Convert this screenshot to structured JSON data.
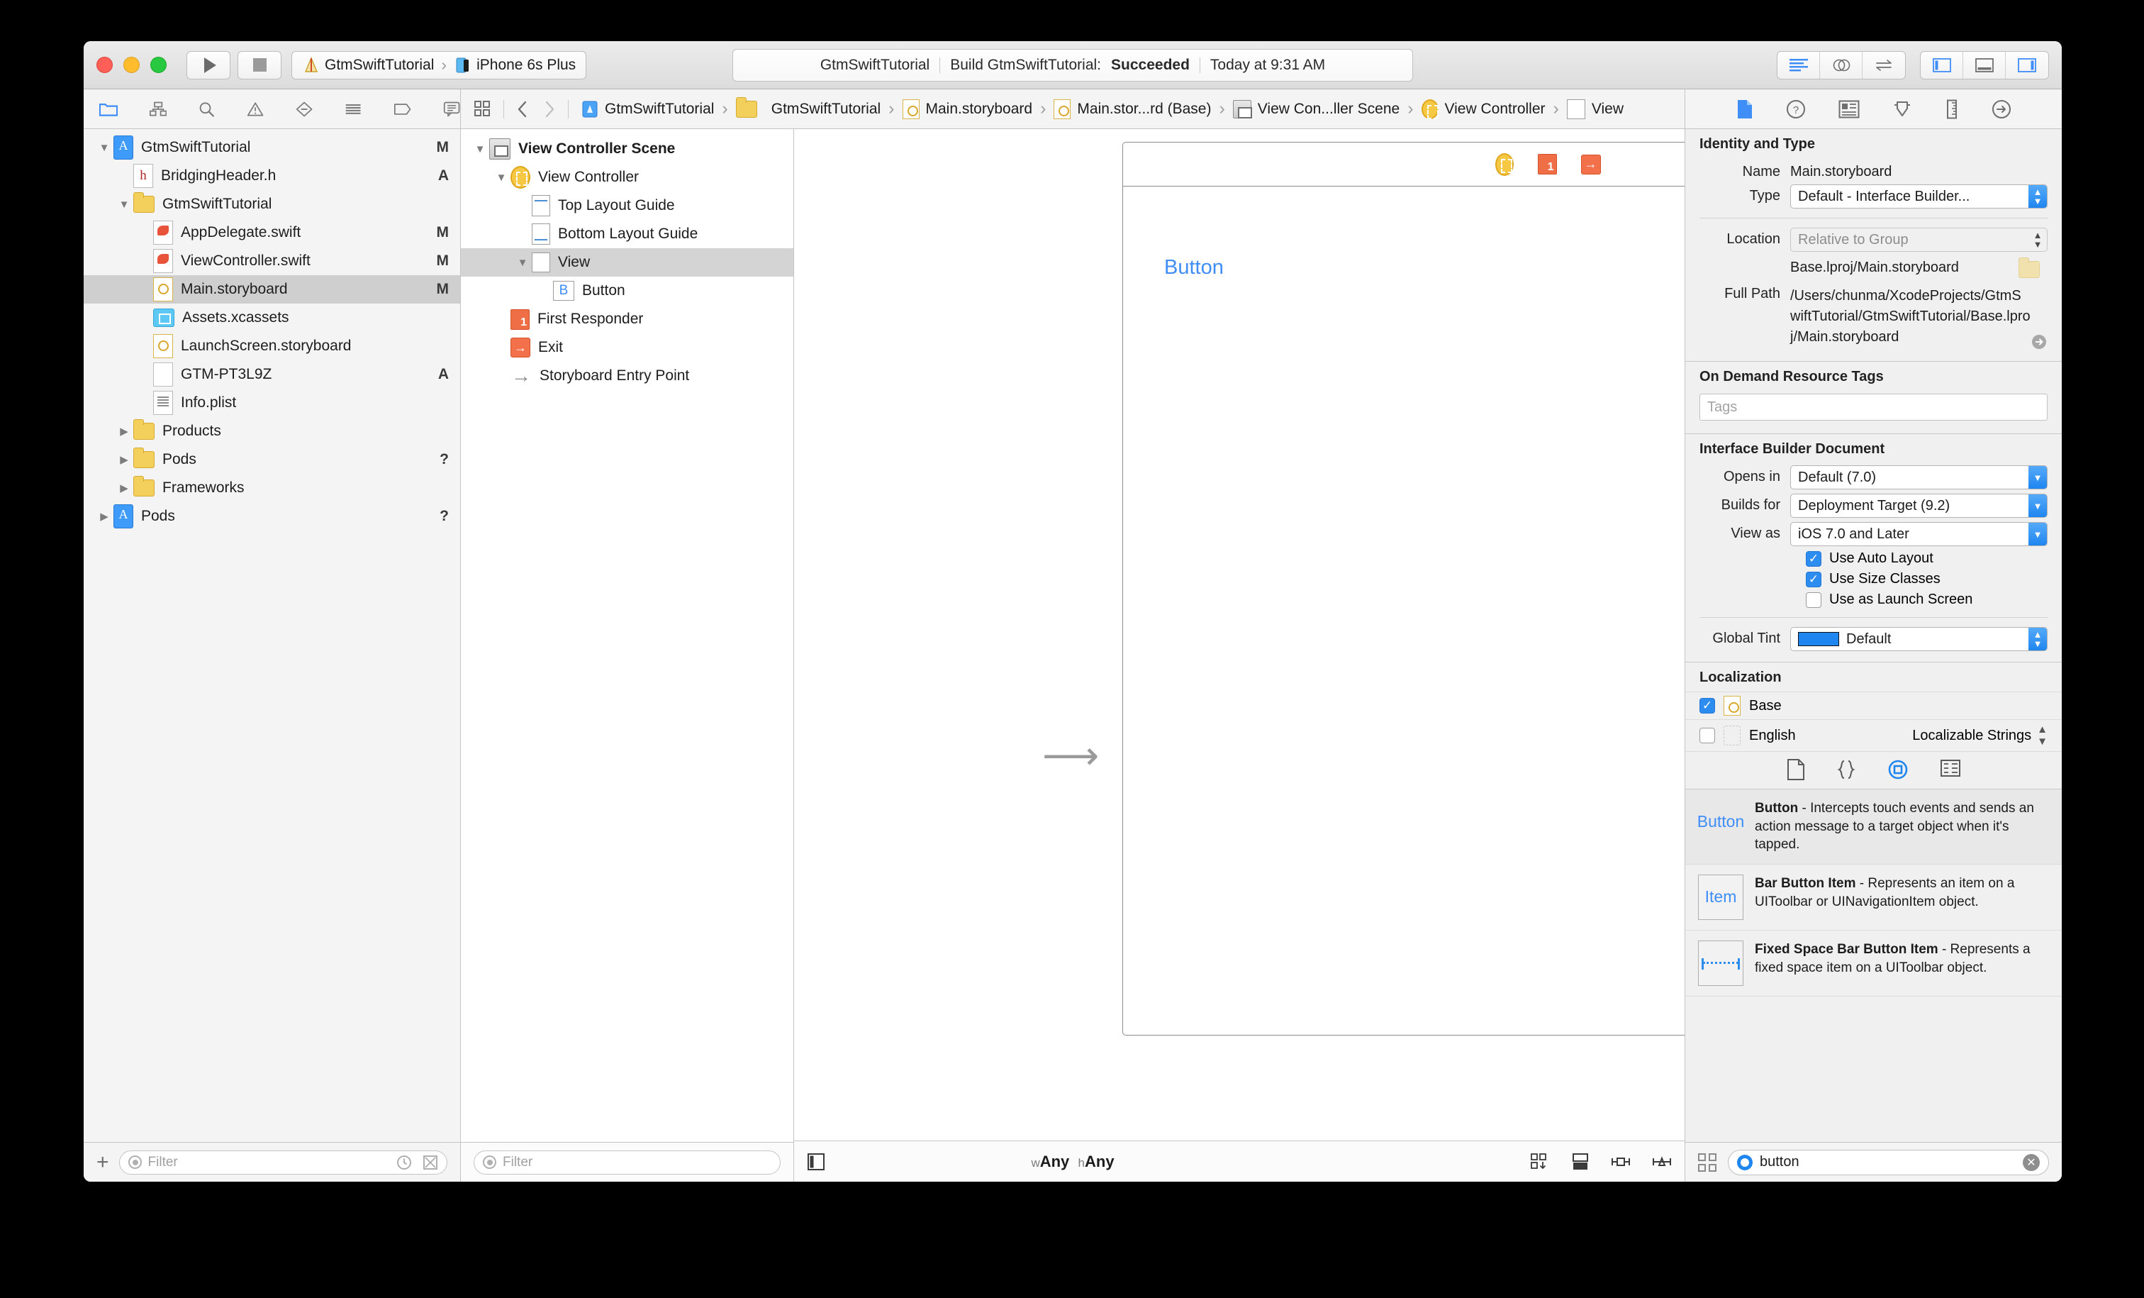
{
  "titlebar": {
    "run_label": "run-icon",
    "stop_label": "stop-icon",
    "scheme": "GtmSwiftTutorial",
    "destination": "iPhone 6s Plus",
    "separator": "›",
    "status_project": "GtmSwiftTutorial",
    "status_action": "Build GtmSwiftTutorial:",
    "status_result": "Succeeded",
    "status_time": "Today at 9:31 AM"
  },
  "jump_bar": {
    "crumbs": [
      {
        "label": "GtmSwiftTutorial",
        "icon": "project-icon"
      },
      {
        "label": "GtmSwiftTutorial",
        "icon": "folder-icon"
      },
      {
        "label": "Main.storyboard",
        "icon": "storyboard-icon"
      },
      {
        "label": "Main.stor...rd (Base)",
        "icon": "storyboard-icon"
      },
      {
        "label": "View Con...ller Scene",
        "icon": "scene-icon"
      },
      {
        "label": "View Controller",
        "icon": "view-controller-icon"
      },
      {
        "label": "View",
        "icon": "view-icon"
      }
    ],
    "arrow": "›"
  },
  "navigator": {
    "toolbar_icons": [
      "folder-icon",
      "source-control-icon",
      "search-icon",
      "warning-icon",
      "test-icon",
      "debug-icon",
      "breakpoint-icon",
      "report-icon"
    ],
    "items": [
      {
        "label": "GtmSwiftTutorial",
        "indent": 0,
        "disc": "open",
        "icon": "project-icon",
        "status": "M",
        "selected": false
      },
      {
        "label": "BridgingHeader.h",
        "indent": 1,
        "disc": "none",
        "icon": "header-icon",
        "status": "A",
        "selected": false
      },
      {
        "label": "GtmSwiftTutorial",
        "indent": 1,
        "disc": "open",
        "icon": "folder-icon",
        "status": "",
        "selected": false
      },
      {
        "label": "AppDelegate.swift",
        "indent": 2,
        "disc": "none",
        "icon": "swift-icon",
        "status": "M",
        "selected": false
      },
      {
        "label": "ViewController.swift",
        "indent": 2,
        "disc": "none",
        "icon": "swift-icon",
        "status": "M",
        "selected": false
      },
      {
        "label": "Main.storyboard",
        "indent": 2,
        "disc": "none",
        "icon": "storyboard-icon",
        "status": "M",
        "selected": true
      },
      {
        "label": "Assets.xcassets",
        "indent": 2,
        "disc": "none",
        "icon": "assets-icon",
        "status": "",
        "selected": false
      },
      {
        "label": "LaunchScreen.storyboard",
        "indent": 2,
        "disc": "none",
        "icon": "storyboard-icon",
        "status": "",
        "selected": false
      },
      {
        "label": "GTM-PT3L9Z",
        "indent": 2,
        "disc": "none",
        "icon": "blank-file-icon",
        "status": "A",
        "selected": false
      },
      {
        "label": "Info.plist",
        "indent": 2,
        "disc": "none",
        "icon": "plist-icon",
        "status": "",
        "selected": false
      },
      {
        "label": "Products",
        "indent": 1,
        "disc": "closed",
        "icon": "folder-icon",
        "status": "",
        "selected": false
      },
      {
        "label": "Pods",
        "indent": 1,
        "disc": "closed",
        "icon": "folder-icon",
        "status": "?",
        "selected": false
      },
      {
        "label": "Frameworks",
        "indent": 1,
        "disc": "closed",
        "icon": "folder-icon",
        "status": "",
        "selected": false
      },
      {
        "label": "Pods",
        "indent": 0,
        "disc": "closed",
        "icon": "project-icon",
        "status": "?",
        "selected": false
      }
    ],
    "filter_placeholder": "Filter",
    "add_label": "+"
  },
  "outline": {
    "items": [
      {
        "label": "View Controller Scene",
        "indent": 0,
        "disc": "open",
        "icon": "scene-icon",
        "bold": true,
        "selected": false
      },
      {
        "label": "View Controller",
        "indent": 1,
        "disc": "open",
        "icon": "view-controller-icon",
        "bold": false,
        "selected": false
      },
      {
        "label": "Top Layout Guide",
        "indent": 2,
        "disc": "none",
        "icon": "top-layout-guide-icon",
        "bold": false,
        "selected": false
      },
      {
        "label": "Bottom Layout Guide",
        "indent": 2,
        "disc": "none",
        "icon": "bottom-layout-guide-icon",
        "bold": false,
        "selected": false
      },
      {
        "label": "View",
        "indent": 2,
        "disc": "open",
        "icon": "view-icon",
        "bold": false,
        "selected": true
      },
      {
        "label": "Button",
        "indent": 3,
        "disc": "none",
        "icon": "button-icon",
        "bold": false,
        "selected": false
      },
      {
        "label": "First Responder",
        "indent": 1,
        "disc": "none",
        "icon": "first-responder-icon",
        "bold": false,
        "selected": false
      },
      {
        "label": "Exit",
        "indent": 1,
        "disc": "none",
        "icon": "exit-icon",
        "bold": false,
        "selected": false
      },
      {
        "label": "Storyboard Entry Point",
        "indent": 1,
        "disc": "none",
        "icon": "entry-point-icon",
        "bold": false,
        "selected": false
      }
    ],
    "filter_placeholder": "Filter"
  },
  "canvas": {
    "button_label": "Button",
    "size_class_w_prefix": "w",
    "size_class_w": "Any",
    "size_class_h_prefix": "h",
    "size_class_h": "Any",
    "dock_icons": [
      "view-controller-icon",
      "first-responder-icon",
      "exit-icon"
    ],
    "bottom_right_icons": [
      "auto-layout-issues-icon",
      "embed-in-icon",
      "align-icon",
      "pin-icon",
      "resolve-icon"
    ]
  },
  "inspector": {
    "toolbar_icons": [
      "file-inspector-icon",
      "quick-help-icon",
      "identity-inspector-icon",
      "attributes-inspector-icon",
      "size-inspector-icon",
      "connections-inspector-icon"
    ],
    "identity": {
      "title": "Identity and Type",
      "name_label": "Name",
      "name_value": "Main.storyboard",
      "type_label": "Type",
      "type_value": "Default - Interface Builder...",
      "location_label": "Location",
      "location_value": "Relative to Group",
      "relative_path": "Base.lproj/Main.storyboard",
      "full_path_label": "Full Path",
      "full_path_value": "/Users/chunma/XcodeProjects/GtmSwiftTutorial/GtmSwiftTutorial/Base.lproj/Main.storyboard"
    },
    "odr": {
      "title": "On Demand Resource Tags",
      "tags_placeholder": "Tags"
    },
    "ib_document": {
      "title": "Interface Builder Document",
      "opens_in_label": "Opens in",
      "opens_in_value": "Default (7.0)",
      "builds_for_label": "Builds for",
      "builds_for_value": "Deployment Target (9.2)",
      "view_as_label": "View as",
      "view_as_value": "iOS 7.0 and Later",
      "auto_layout_label": "Use Auto Layout",
      "auto_layout_checked": true,
      "size_classes_label": "Use Size Classes",
      "size_classes_checked": true,
      "launch_screen_label": "Use as Launch Screen",
      "launch_screen_checked": false,
      "global_tint_label": "Global Tint",
      "global_tint_value": "Default",
      "global_tint_color": "#1f86f0"
    },
    "localization": {
      "title": "Localization",
      "rows": [
        {
          "label": "Base",
          "checked": true,
          "type": ""
        },
        {
          "label": "English",
          "checked": false,
          "type": "Localizable Strings"
        }
      ],
      "icons": [
        "file-type-icon",
        "strings-dict-icon",
        "interface-builder-icon",
        "strings-file-icon"
      ]
    },
    "library": {
      "items": [
        {
          "icon_text": "Button",
          "icon_kind": "text",
          "title": "Button",
          "desc": " - Intercepts touch events and sends an action message to a target object when it's tapped.",
          "selected": true
        },
        {
          "icon_text": "Item",
          "icon_kind": "boxed",
          "title": "Bar Button Item",
          "desc": " - Represents an item on a UIToolbar or UINavigationItem object.",
          "selected": false
        },
        {
          "icon_text": "",
          "icon_kind": "dotted",
          "title": "Fixed Space Bar Button Item",
          "desc": " - Represents a fixed space item on a UIToolbar object.",
          "selected": false
        }
      ],
      "search_value": "button"
    }
  }
}
